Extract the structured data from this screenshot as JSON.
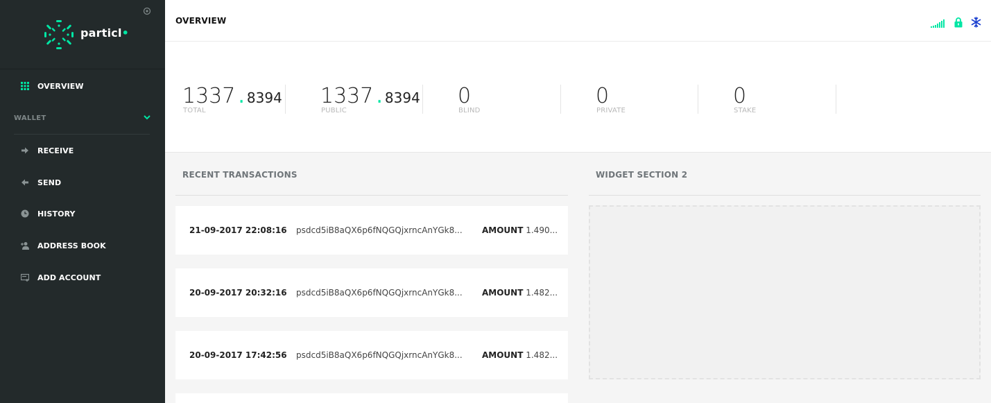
{
  "sidebar": {
    "logo_text": "particl",
    "logo_dot": "•",
    "nav": {
      "overview": "OVERVIEW",
      "wallet_section": "WALLET",
      "receive": "RECEIVE",
      "send": "SEND",
      "history": "HISTORY",
      "address_book": "ADDRESS BOOK",
      "add_account": "ADD ACCOUNT"
    }
  },
  "header": {
    "title": "OVERVIEW",
    "icons": [
      "signal-icon",
      "lock-icon",
      "snowflake-icon"
    ]
  },
  "balances": [
    {
      "int": "1337",
      "dec": "8394",
      "label": "TOTAL"
    },
    {
      "int": "1337",
      "dec": "8394",
      "label": "PUBLIC"
    },
    {
      "int": "0",
      "dec": "",
      "label": "BLIND"
    },
    {
      "int": "0",
      "dec": "",
      "label": "PRIVATE"
    },
    {
      "int": "0",
      "dec": "",
      "label": "STAKE"
    }
  ],
  "transactions": {
    "heading": "RECENT TRANSACTIONS",
    "amount_label": "AMOUNT",
    "rows": [
      {
        "date": "21-09-2017 22:08:16",
        "address": "psdcd5iB8aQX6p6fNQGQjxrncAnYGk8...",
        "amount": "1.490..."
      },
      {
        "date": "20-09-2017 20:32:16",
        "address": "psdcd5iB8aQX6p6fNQGQjxrncAnYGk8...",
        "amount": "1.482..."
      },
      {
        "date": "20-09-2017 17:42:56",
        "address": "psdcd5iB8aQX6p6fNQGQjxrncAnYGk8...",
        "amount": "1.482..."
      }
    ]
  },
  "widget2": {
    "heading": "WIDGET SECTION 2"
  },
  "colors": {
    "accent": "#00e6a4",
    "sidebar_bg": "#232a2b",
    "snowflake": "#1a3fcf"
  }
}
